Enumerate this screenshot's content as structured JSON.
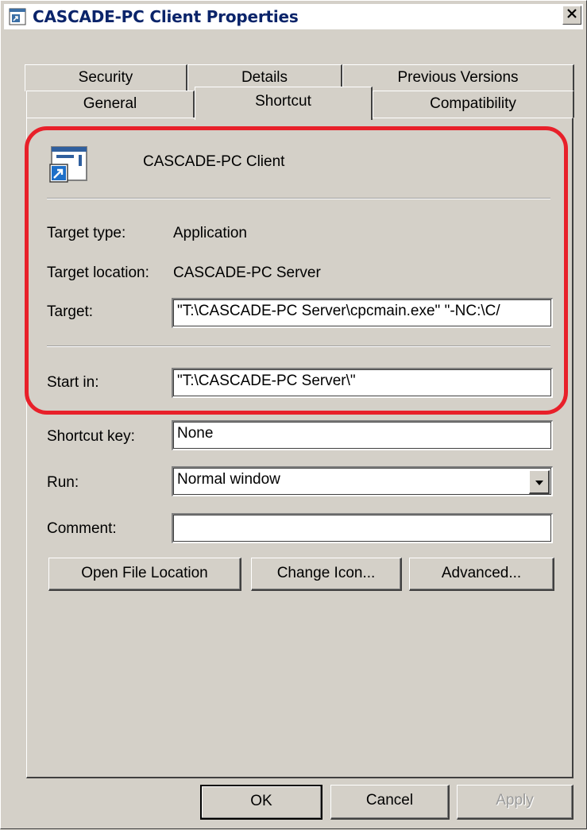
{
  "window": {
    "title": "CASCADE-PC Client Properties"
  },
  "tabs": {
    "row1": [
      "Security",
      "Details",
      "Previous Versions"
    ],
    "row2": [
      "General",
      "Shortcut",
      "Compatibility"
    ],
    "active": "Shortcut"
  },
  "shortcut": {
    "name": "CASCADE-PC Client",
    "target_type_label": "Target type:",
    "target_type_value": "Application",
    "target_location_label": "Target location:",
    "target_location_value": "CASCADE-PC Server",
    "target_label": "Target:",
    "target_value": "\"T:\\CASCADE-PC Server\\cpcmain.exe\" \"-NC:\\C/",
    "start_in_label": "Start in:",
    "start_in_value": "\"T:\\CASCADE-PC Server\\\"",
    "shortcut_key_label": "Shortcut key:",
    "shortcut_key_value": "None",
    "run_label": "Run:",
    "run_value": "Normal window",
    "comment_label": "Comment:",
    "comment_value": ""
  },
  "buttons": {
    "open_file_location": "Open File Location",
    "change_icon": "Change Icon...",
    "advanced": "Advanced...",
    "ok": "OK",
    "cancel": "Cancel",
    "apply": "Apply"
  },
  "icons": {
    "title": "shortcut-app-icon",
    "close": "close-icon",
    "shortcut": "shortcut-app-icon",
    "dropdown": "chevron-down-icon"
  },
  "colors": {
    "highlight": "#e8202a",
    "title_text": "#0a246a",
    "dialog_bg": "#d4d0c8"
  }
}
